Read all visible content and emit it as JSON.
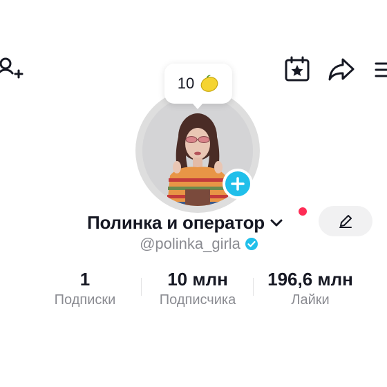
{
  "header": {
    "add_friend_icon": "person-add-icon",
    "calendar_icon": "calendar-star-icon",
    "share_icon": "share-arrow-icon",
    "menu_icon": "hamburger-menu-icon"
  },
  "profile": {
    "bubble_count": "10",
    "bubble_emoji": "🍋",
    "display_name": "Полинка и оператор",
    "username": "@polinka_girla",
    "verified": true,
    "notification_dot_color": "#fe2c55",
    "plus_button_color": "#20bfea",
    "verified_color": "#20bfea"
  },
  "stats": [
    {
      "value": "1",
      "label": "Подписки"
    },
    {
      "value": "10 млн",
      "label": "Подписчика"
    },
    {
      "value": "196,6 млн",
      "label": "Лайки"
    }
  ]
}
